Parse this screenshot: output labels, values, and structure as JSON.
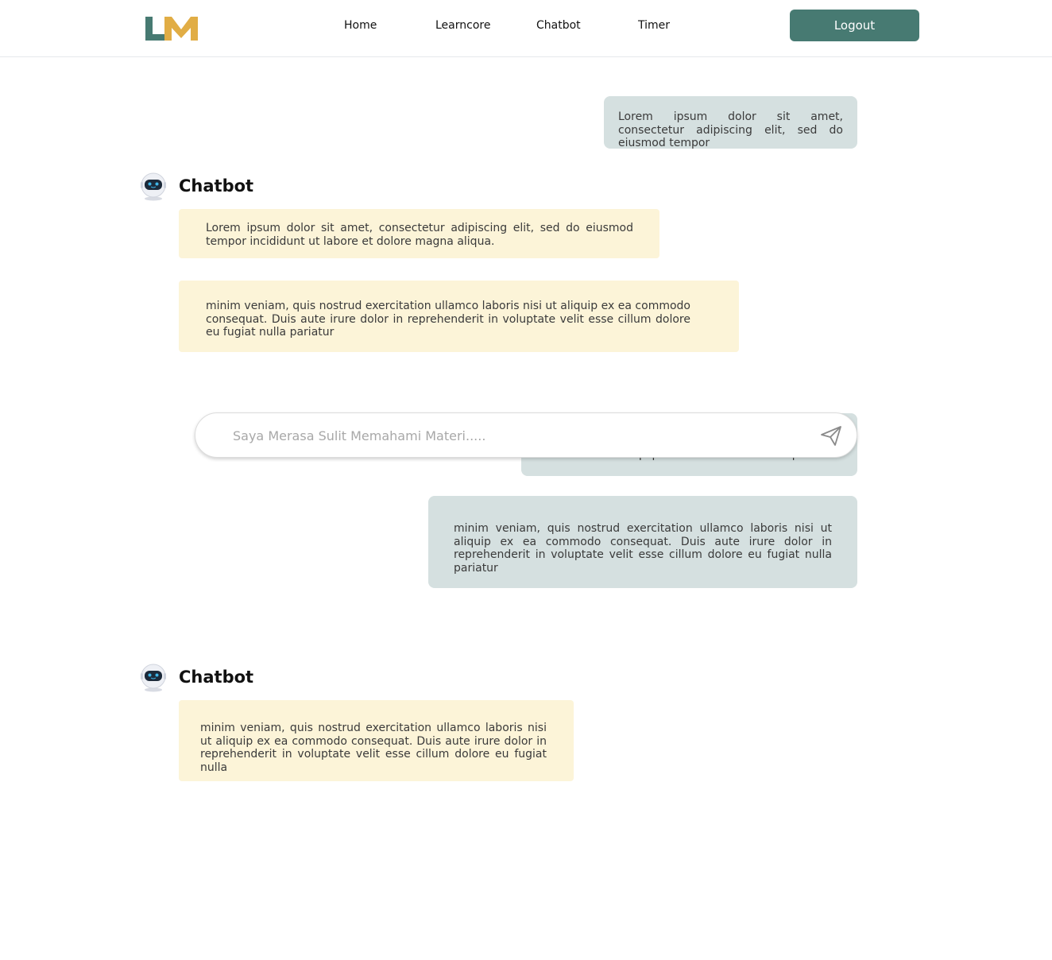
{
  "nav": {
    "logo": "LM",
    "links": [
      "Home",
      "Learncore",
      "Chatbot",
      "Timer"
    ],
    "logout_label": "Logout"
  },
  "colors": {
    "primary": "#477a72",
    "logo_l": "#477a72",
    "logo_m": "#e1ad45",
    "user_bubble": "#d5e0e0",
    "bot_bubble": "#fcf4d8"
  },
  "messages": {
    "user_1": "Lorem ipsum dolor sit amet, consectetur adipiscing elit, sed do eiusmod tempor",
    "bot_name": "Chatbot",
    "bot_1a": "Lorem ipsum dolor sit amet, consectetur adipiscing elit, sed do eiusmod tempor incididunt ut labore et dolore magna aliqua.",
    "bot_1b": "minim veniam, quis nostrud exercitation ullamco laboris nisi ut aliquip ex ea commodo consequat. Duis aute irure dolor in reprehenderit in voluptate velit esse cillum dolore eu fugiat nulla pariatur",
    "user_2_partial": "laboris nisi ut aliquip ex ea commodo consequat.",
    "user_3": "minim veniam, quis nostrud exercitation ullamco laboris nisi ut aliquip ex ea commodo consequat. Duis aute irure dolor in reprehenderit in voluptate velit esse cillum dolore eu fugiat nulla pariatur",
    "bot_2": "minim veniam, quis nostrud exercitation ullamco laboris nisi ut aliquip ex ea commodo consequat. Duis aute irure dolor in reprehenderit in voluptate velit esse cillum dolore eu fugiat nulla"
  },
  "input": {
    "placeholder": "Saya Merasa Sulit Memahami Materi.....",
    "value": ""
  },
  "icons": {
    "send": "paper-plane-icon",
    "bot_avatar": "robot-icon"
  }
}
